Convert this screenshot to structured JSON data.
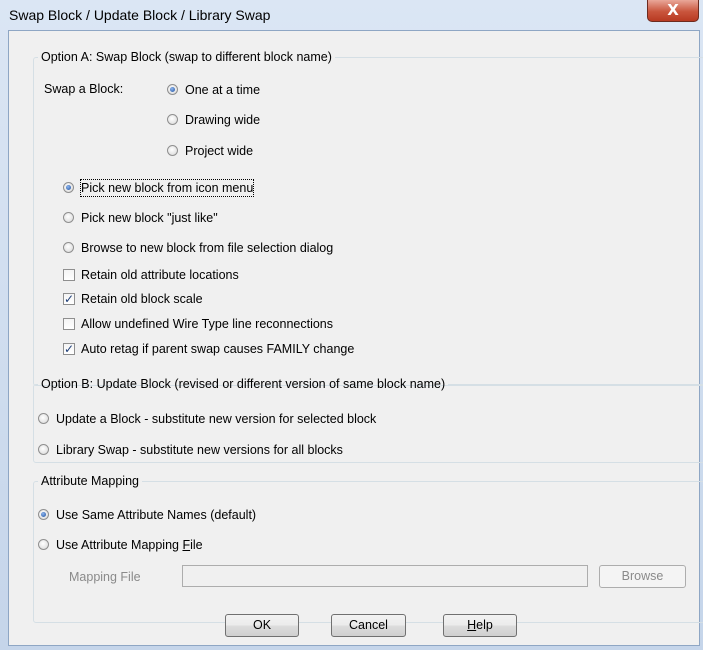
{
  "window": {
    "title": "Swap Block / Update Block / Library Swap",
    "close_symbol": "X"
  },
  "option_a": {
    "legend": "Option A: Swap Block (swap to different block name)",
    "swap_label": "Swap a Block:",
    "scope_options": [
      {
        "label": "One at a time",
        "selected": true
      },
      {
        "label": "Drawing wide",
        "selected": false
      },
      {
        "label": "Project wide",
        "selected": false
      }
    ],
    "pick_options": [
      {
        "label": "Pick new block from icon menu",
        "selected": true
      },
      {
        "label": "Pick new block \"just like\"",
        "selected": false
      },
      {
        "label": "Browse to new block from file selection dialog",
        "selected": false
      }
    ],
    "checkboxes": [
      {
        "label": "Retain old attribute locations",
        "checked": false
      },
      {
        "label": "Retain old block scale",
        "checked": true
      },
      {
        "label": "Allow undefined Wire Type line reconnections",
        "checked": false
      },
      {
        "label": "Auto retag if parent swap causes FAMILY change",
        "checked": true
      }
    ]
  },
  "option_b": {
    "legend": "Option B: Update Block (revised or different version of same block name)",
    "options": [
      {
        "label": "Update a Block - substitute new version for selected block",
        "selected": false
      },
      {
        "label": "Library Swap - substitute new versions for all blocks",
        "selected": false
      }
    ]
  },
  "attribute_mapping": {
    "legend": "Attribute Mapping",
    "options": [
      {
        "label": "Use Same Attribute Names (default)",
        "selected": true
      },
      {
        "label": "Use Attribute Mapping ",
        "selected": false,
        "mnemonic": "F",
        "suffix": "ile"
      }
    ],
    "mapping_file_label": "Mapping File",
    "mapping_file_value": "",
    "browse_label": "Browse"
  },
  "buttons": {
    "ok": "OK",
    "cancel": "Cancel",
    "help_mnemonic": "H",
    "help_rest": "elp"
  }
}
